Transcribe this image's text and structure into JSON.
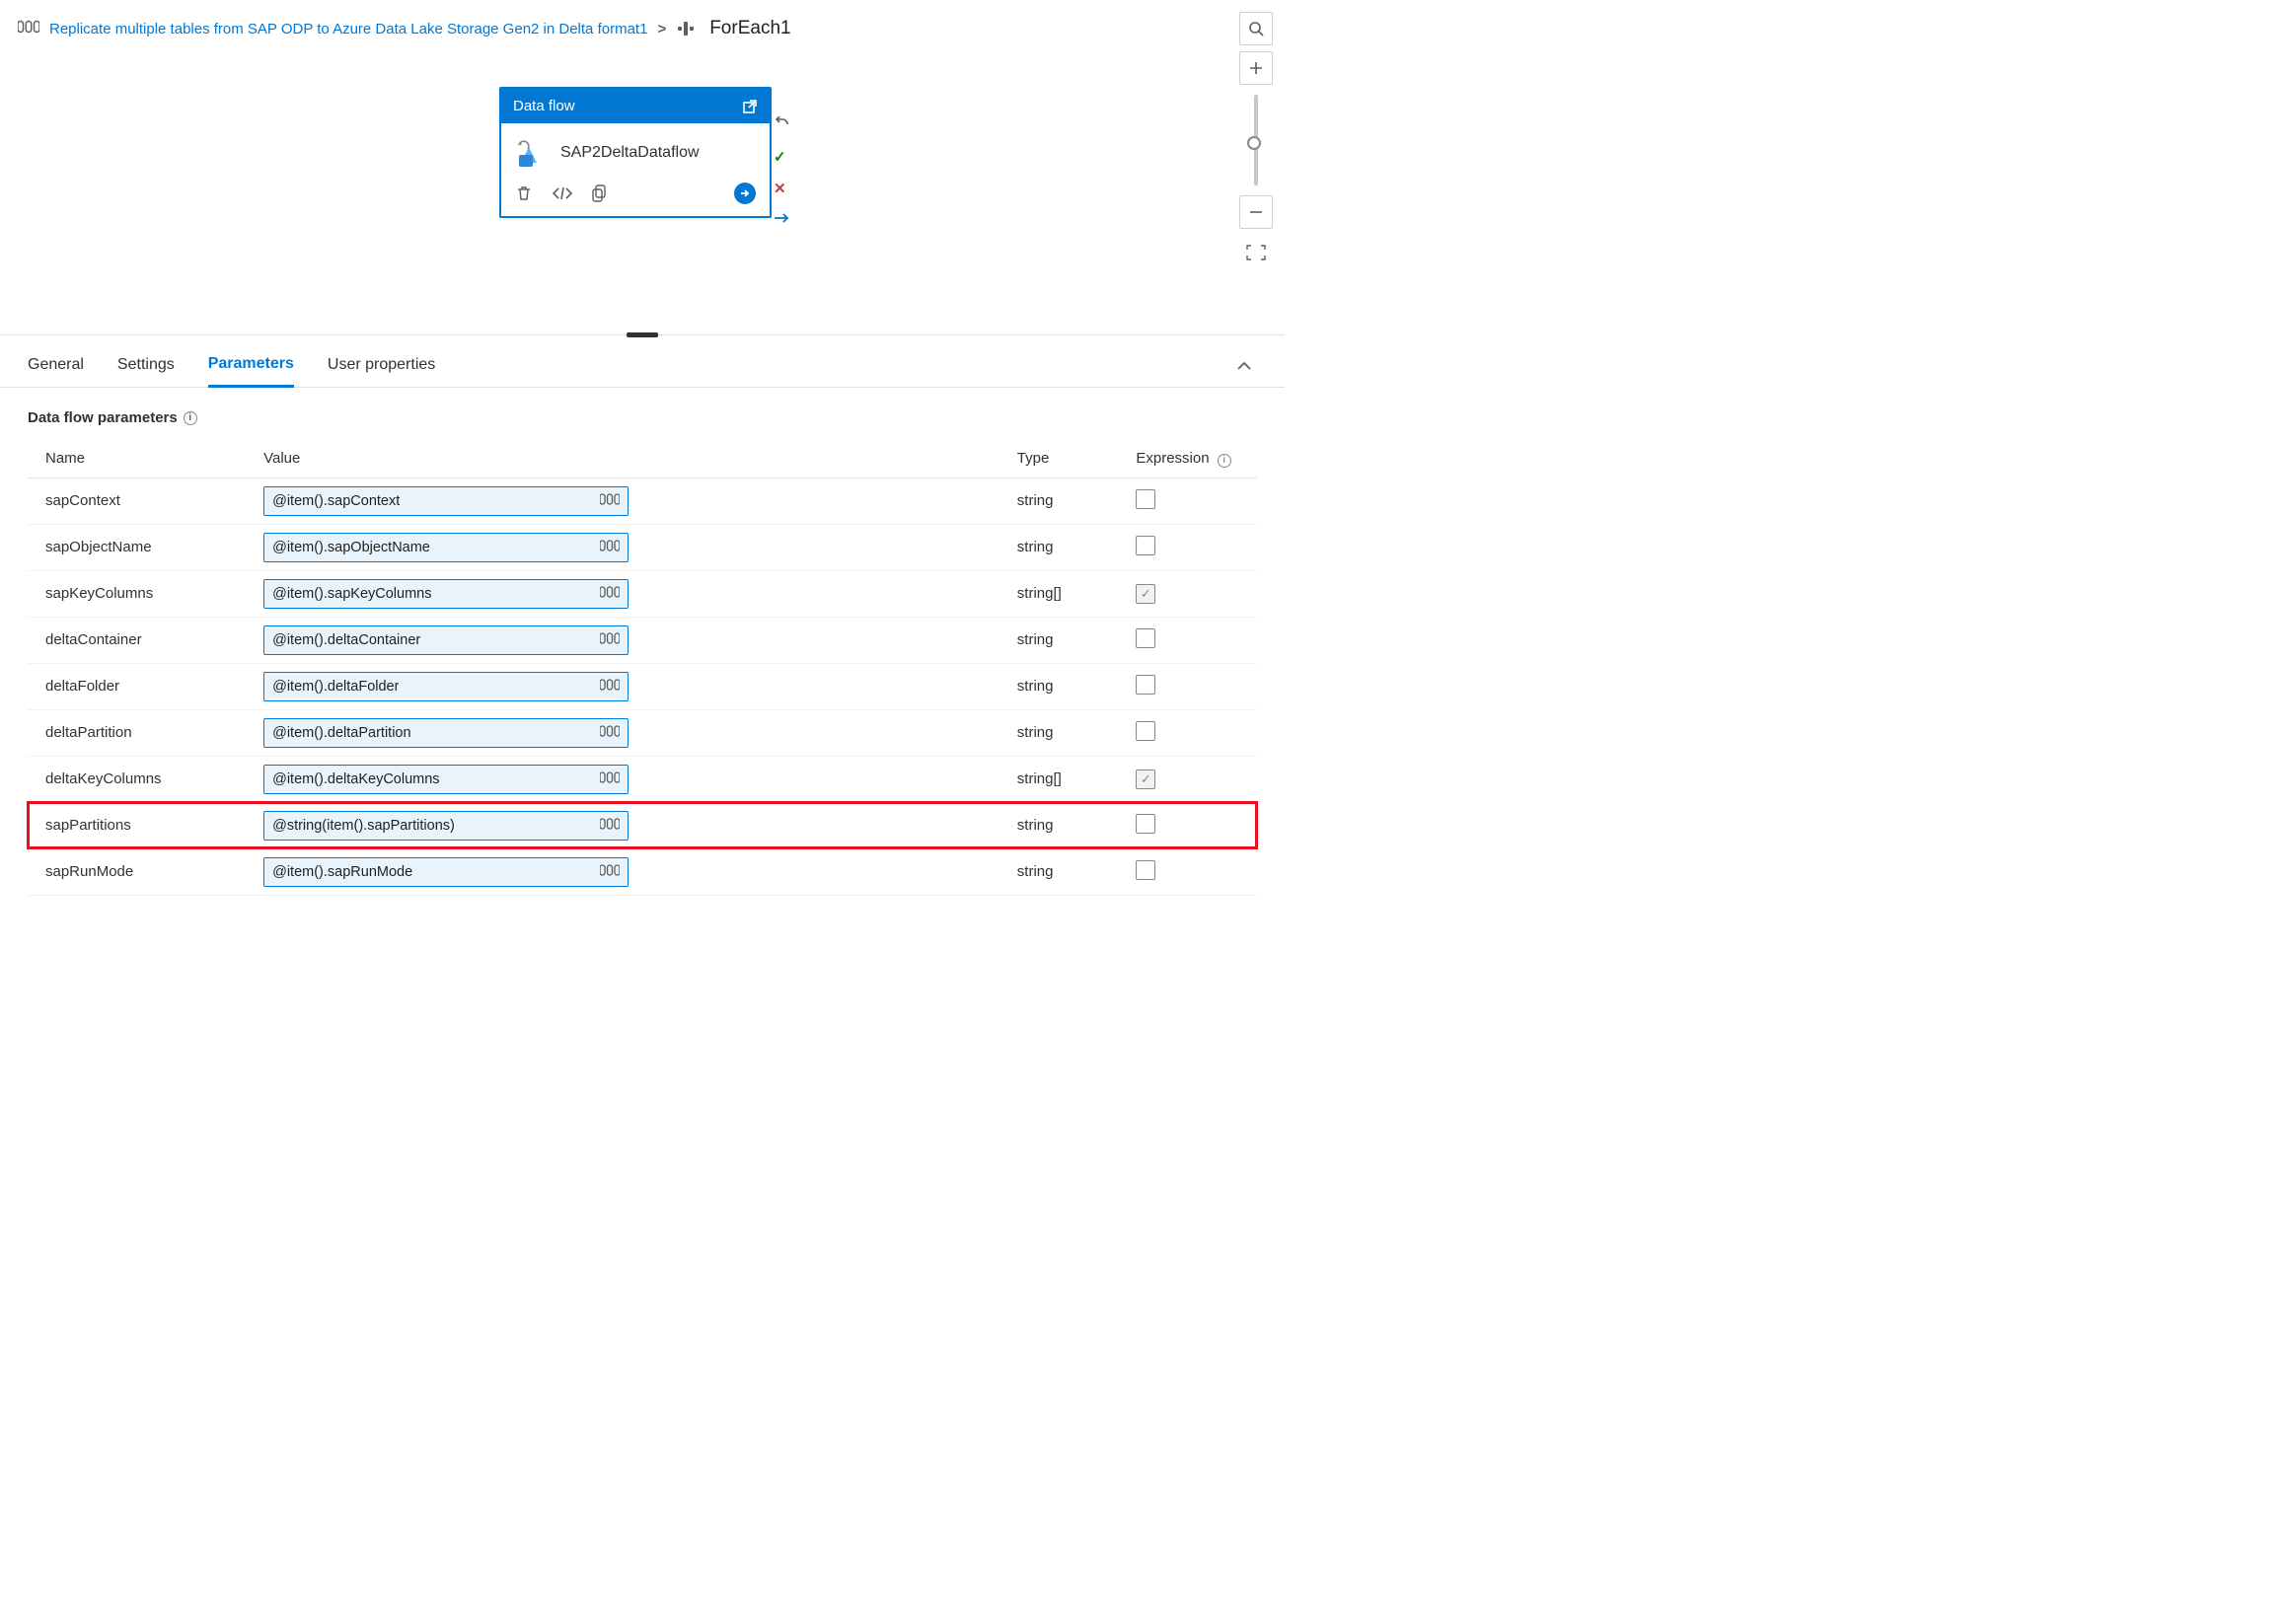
{
  "breadcrumb": {
    "parent_label": "Replicate multiple tables from SAP ODP to Azure Data Lake Storage Gen2 in Delta format1",
    "current_label": "ForEach1"
  },
  "activity": {
    "header": "Data flow",
    "name": "SAP2DeltaDataflow"
  },
  "tabs": {
    "general": "General",
    "settings": "Settings",
    "parameters": "Parameters",
    "user_properties": "User properties"
  },
  "section": {
    "title": "Data flow parameters"
  },
  "columns": {
    "name": "Name",
    "value": "Value",
    "type": "Type",
    "expression": "Expression"
  },
  "rows": [
    {
      "name": "sapContext",
      "value": "@item().sapContext",
      "type": "string",
      "checked": false,
      "highlight": false
    },
    {
      "name": "sapObjectName",
      "value": "@item().sapObjectName",
      "type": "string",
      "checked": false,
      "highlight": false
    },
    {
      "name": "sapKeyColumns",
      "value": "@item().sapKeyColumns",
      "type": "string[]",
      "checked": true,
      "highlight": false
    },
    {
      "name": "deltaContainer",
      "value": "@item().deltaContainer",
      "type": "string",
      "checked": false,
      "highlight": false
    },
    {
      "name": "deltaFolder",
      "value": "@item().deltaFolder",
      "type": "string",
      "checked": false,
      "highlight": false
    },
    {
      "name": "deltaPartition",
      "value": "@item().deltaPartition",
      "type": "string",
      "checked": false,
      "highlight": false
    },
    {
      "name": "deltaKeyColumns",
      "value": "@item().deltaKeyColumns",
      "type": "string[]",
      "checked": true,
      "highlight": false
    },
    {
      "name": "sapPartitions",
      "value": "@string(item().sapPartitions)",
      "type": "string",
      "checked": false,
      "highlight": true
    },
    {
      "name": "sapRunMode",
      "value": "@item().sapRunMode",
      "type": "string",
      "checked": false,
      "highlight": false
    }
  ]
}
